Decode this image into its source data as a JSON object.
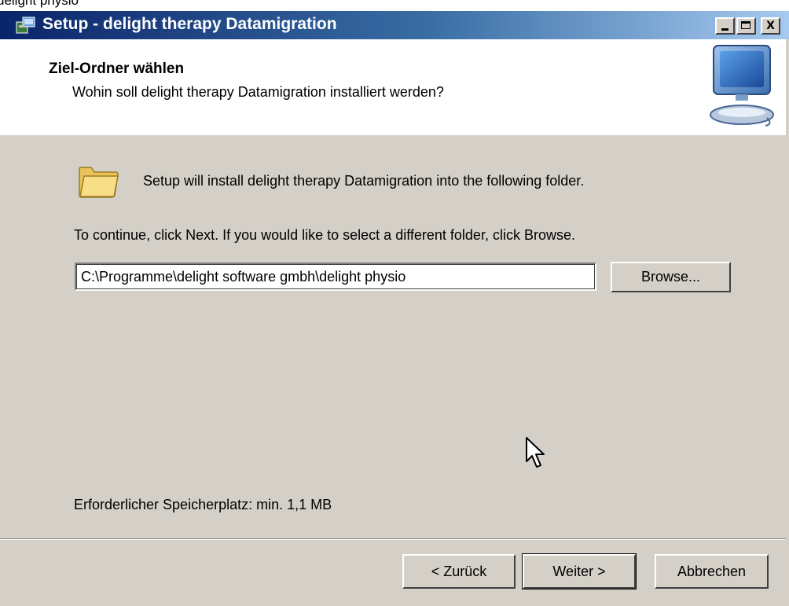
{
  "top_strip_text": "delight physio",
  "window": {
    "title": "Setup - delight therapy Datamigration",
    "controls": {
      "minimize": "_",
      "maximize": "□",
      "close": "X"
    }
  },
  "header": {
    "title": "Ziel-Ordner wählen",
    "subtitle": "Wohin soll delight therapy Datamigration installiert werden?"
  },
  "content": {
    "install_text": "Setup will install delight therapy Datamigration into the following folder.",
    "continue_text": "To continue, click Next. If you would like to select a different folder, click Browse.",
    "path_value": "C:\\Programme\\delight software gmbh\\delight physio",
    "browse_label": "Browse...",
    "required_space": "Erforderlicher Speicherplatz: min. 1,1 MB"
  },
  "footer": {
    "back_label": "< Zurück",
    "next_label": "Weiter >",
    "cancel_label": "Abbrechen"
  },
  "colors": {
    "titlebar_start": "#0a246a",
    "titlebar_end": "#a6caf0",
    "dialog_face": "#d4d0c8"
  },
  "icons": [
    "setup-app-icon",
    "computer-icon",
    "folder-icon",
    "mouse-cursor-icon"
  ]
}
